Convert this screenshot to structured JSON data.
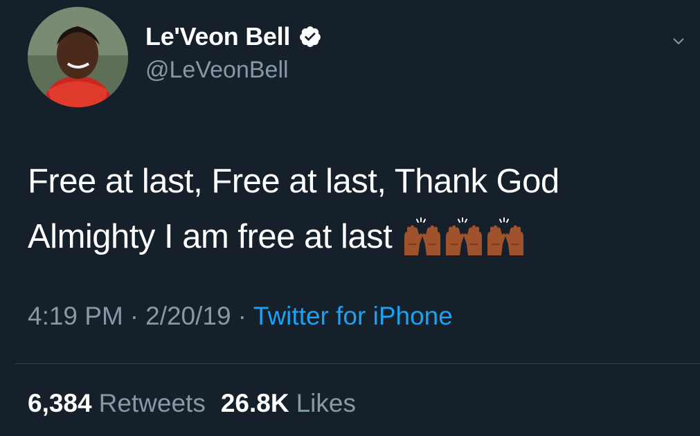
{
  "tweet": {
    "author": {
      "display_name": "Le'Veon Bell",
      "handle": "@LeVeonBell",
      "verified": true,
      "avatar_icon": "profile-photo"
    },
    "text_lines": [
      "Free at last, Free at last, Thank God",
      "Almighty I am free at last"
    ],
    "emoji": [
      "raising-hands-emoji",
      "raising-hands-emoji",
      "raising-hands-emoji"
    ],
    "time": "4:19 PM",
    "date": "2/20/19",
    "separator": "·",
    "source": "Twitter for iPhone",
    "retweets_count": "6,384",
    "retweets_label": "Retweets",
    "likes_count": "26.8K",
    "likes_label": "Likes"
  },
  "colors": {
    "background": "#15202b",
    "text_primary": "#ffffff",
    "text_secondary": "#8899a6",
    "link": "#1da1f2",
    "divider": "#38444d",
    "skin_tone": "#a0522d"
  }
}
